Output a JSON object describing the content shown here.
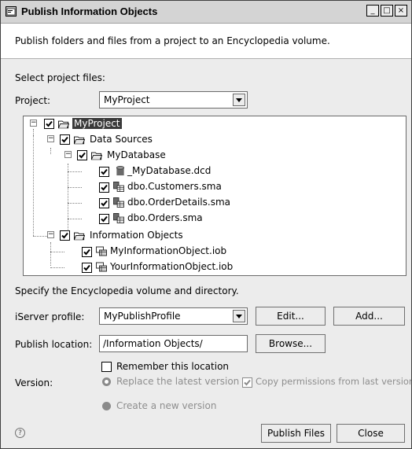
{
  "window": {
    "title": "Publish Information Objects",
    "minimize": "_",
    "maximize": "□",
    "close": "×"
  },
  "banner": {
    "text": "Publish folders and files from a project to an Encyclopedia volume."
  },
  "select_files": {
    "label": "Select project files:",
    "project_label": "Project:",
    "project_value": "MyProject"
  },
  "tree": {
    "root": {
      "label": "MyProject",
      "icon": "folder-icon",
      "checked": true
    },
    "data_sources": {
      "label": "Data Sources",
      "icon": "folder-icon",
      "checked": true
    },
    "my_database": {
      "label": "MyDatabase",
      "icon": "folder-icon",
      "checked": true
    },
    "items_db": [
      {
        "label": "_MyDatabase.dcd",
        "icon": "database-icon",
        "checked": true
      },
      {
        "label": "dbo.Customers.sma",
        "icon": "table-icon",
        "checked": true
      },
      {
        "label": "dbo.OrderDetails.sma",
        "icon": "table-icon",
        "checked": true
      },
      {
        "label": "dbo.Orders.sma",
        "icon": "table-icon",
        "checked": true
      }
    ],
    "info_objects": {
      "label": "Information Objects",
      "icon": "folder-icon",
      "checked": true
    },
    "items_io": [
      {
        "label": "MyInformationObject.iob",
        "icon": "info-object-icon",
        "checked": true
      },
      {
        "label": "YourInformationObject.iob",
        "icon": "info-object-icon",
        "checked": true
      }
    ]
  },
  "publish": {
    "heading": "Specify the Encyclopedia volume and directory.",
    "iserver_label": "iServer profile:",
    "iserver_value": "MyPublishProfile",
    "edit_label": "Edit...",
    "add_label": "Add...",
    "location_label": "Publish location:",
    "location_value": "/Information Objects/",
    "browse_label": "Browse...",
    "remember_label": "Remember this location",
    "version_label": "Version:",
    "replace_label": "Replace the latest version",
    "copy_perm_label": "Copy permissions from last version",
    "create_new_label": "Create a new version"
  },
  "footer": {
    "help": "?",
    "publish_label": "Publish Files",
    "close_label": "Close"
  },
  "colors": {
    "selection": "#3a3a3a",
    "dialog_bg": "#ececec"
  }
}
